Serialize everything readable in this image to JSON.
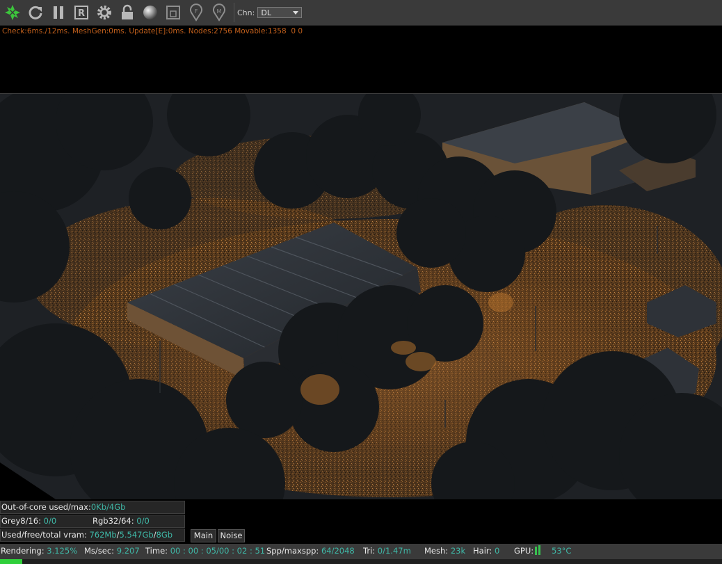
{
  "toolbar": {
    "icons": [
      "octane-logo-icon",
      "refresh-icon",
      "pause-icon",
      "reset-r-icon",
      "settings-gear-icon",
      "lock-icon",
      "material-sphere-icon",
      "region-render-icon",
      "focus-picker-icon",
      "material-picker-icon"
    ],
    "channel_label": "Chn:",
    "channel_value": "DL"
  },
  "stats_line": "Check:6ms./12ms. MeshGen:0ms. Update[E]:0ms. Nodes:2756 Movable:1358  0 0",
  "info": {
    "out_of_core_label": "Out-of-core used/max:",
    "out_of_core_value": "0Kb/4Gb",
    "grey_label": "Grey8/16:",
    "grey_value": "0/0",
    "rgb_label": "Rgb32/64:",
    "rgb_value": "0/0",
    "vram_label": "Used/free/total vram:",
    "vram_used": "762Mb",
    "vram_free": "5.547Gb",
    "vram_total": "8Gb",
    "slash": "/"
  },
  "tabs": [
    "Main",
    "Noise"
  ],
  "status": {
    "rendering_label": "Rendering:",
    "rendering_value": "3.125%",
    "ms_label": "Ms/sec:",
    "ms_value": "9.207",
    "time_label": "Time:",
    "time_value": "00 : 00 : 05/00 : 02 : 51",
    "spp_label": "Spp/maxspp:",
    "spp_value": "64/2048",
    "tri_label": "Tri:",
    "tri_value": "0/1.47m",
    "mesh_label": "Mesh:",
    "mesh_value": "23k",
    "hair_label": "Hair:",
    "hair_value": "0",
    "gpu_label": "GPU:",
    "gpu_temp": "53°C",
    "progress": 0.03125
  },
  "colors": {
    "accent_green": "#2fcf3a",
    "value_teal": "#3fb9a8",
    "stats_orange": "#c2601c",
    "light_glow": "#a8682a"
  }
}
